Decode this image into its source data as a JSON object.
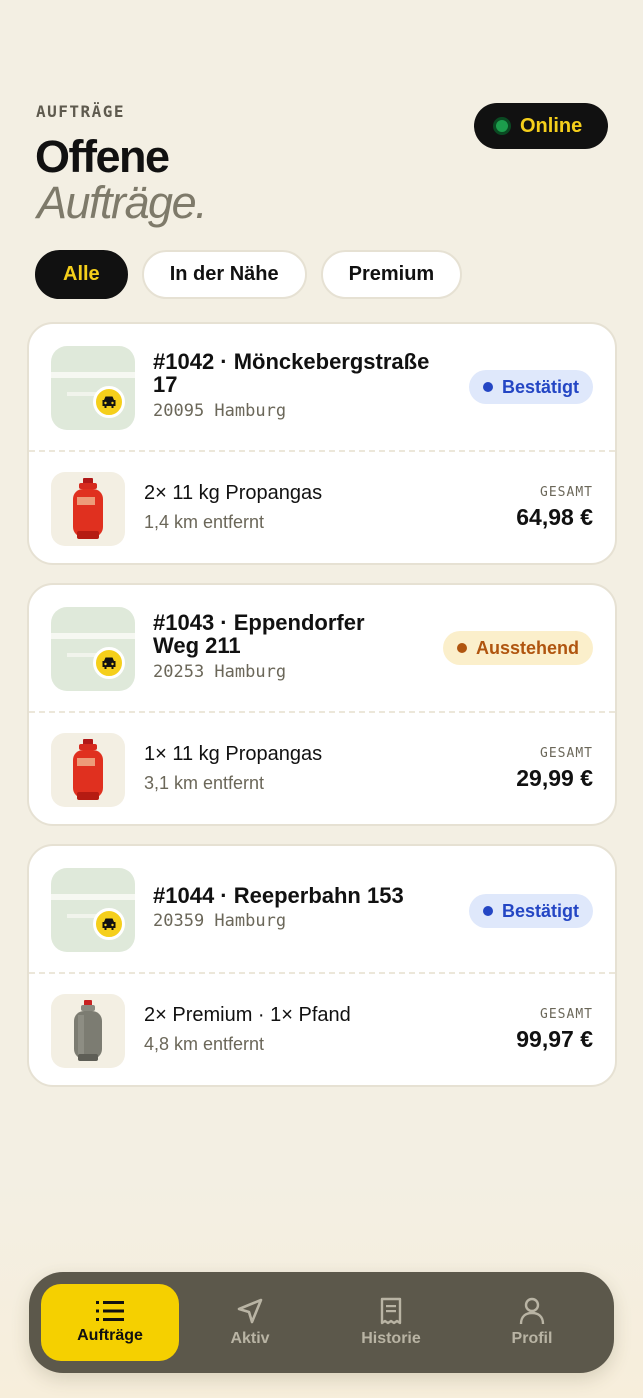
{
  "header": {
    "eyebrow": "AUFTRÄGE",
    "title_line1": "Offene",
    "title_line2": "Aufträge."
  },
  "status": {
    "label": "Online",
    "color": "#1c9d4c"
  },
  "filters": [
    "Alle",
    "In der Nähe",
    "Premium"
  ],
  "orders": [
    {
      "title": "#1042 · Mönckebergstraße 17",
      "zip": "20095 Hamburg",
      "badge": "Bestätigt",
      "qty": "2× 11 kg Propangas",
      "distance": "1,4 km entfernt",
      "total_label": "GESAMT",
      "price": "64,98 €"
    },
    {
      "title": "#1043 · Eppendorfer Weg 211",
      "zip": "20253 Hamburg",
      "badge": "Ausstehend",
      "qty": "1× 11 kg Propangas",
      "distance": "3,1 km entfernt",
      "total_label": "GESAMT",
      "price": "29,99 €"
    },
    {
      "title": "#1044 · Reeperbahn 153",
      "zip": "20359 Hamburg",
      "badge": "Bestätigt",
      "qty": "2× Premium · 1× Pfand",
      "distance": "4,8 km entfernt",
      "total_label": "GESAMT",
      "price": "99,97 €"
    }
  ],
  "nav": [
    "Aufträge",
    "Aktiv",
    "Historie",
    "Profil"
  ],
  "colors": {
    "accent": "#f5d000",
    "confirmed": "#2446c4",
    "pending": "#b0550f"
  }
}
